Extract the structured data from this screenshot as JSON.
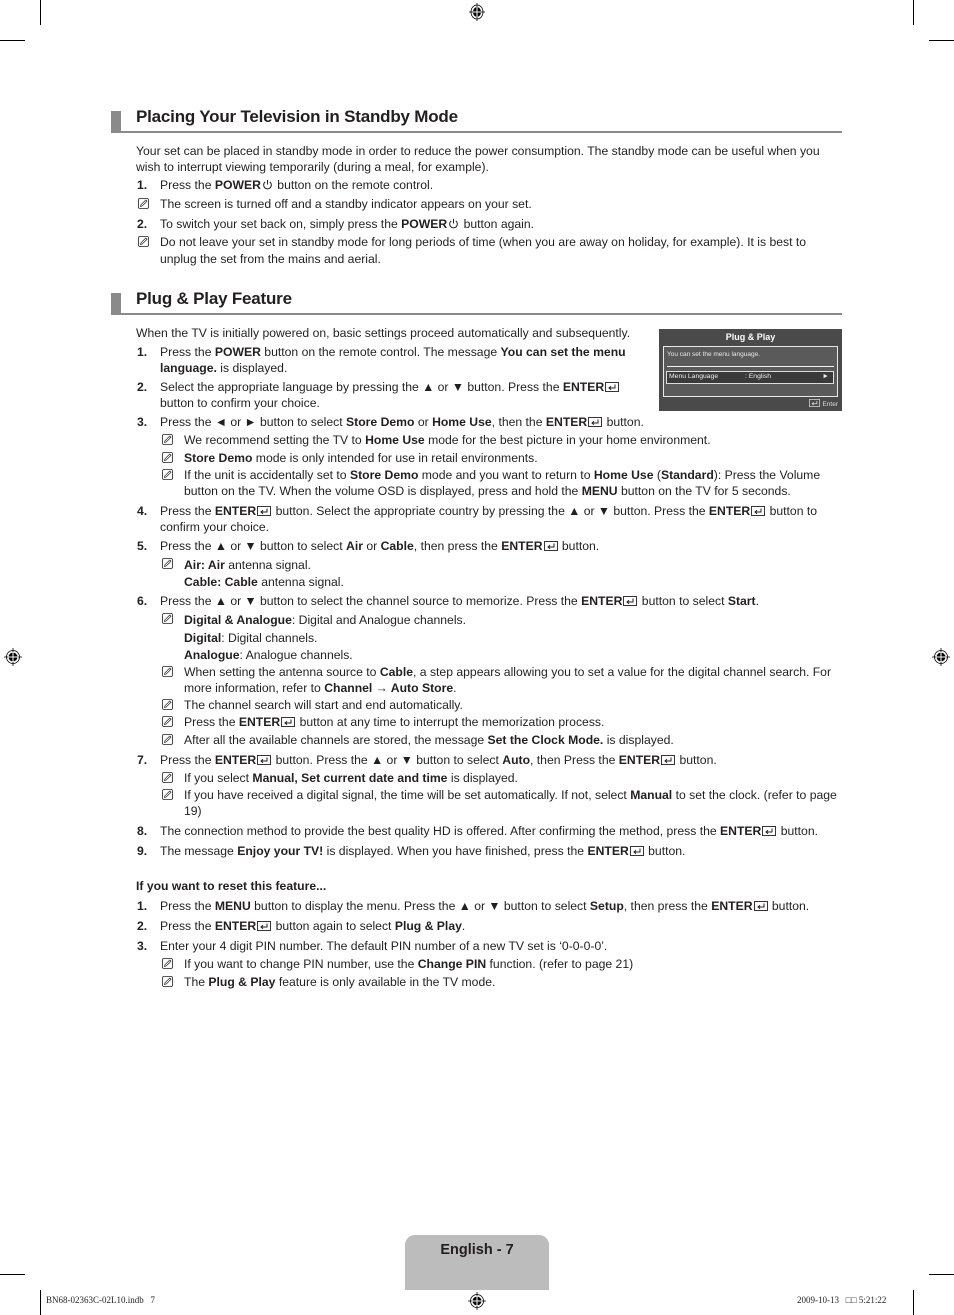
{
  "sections": {
    "standby": {
      "title": "Placing Your Television in Standby Mode",
      "intro_line1": "Your set can be placed in standby mode in order to reduce the power consumption. The standby mode can be useful when you",
      "intro_line2": "wish to interrupt viewing temporarily (during a meal, for example).",
      "step1": {
        "num": "1.",
        "pre": "Press the ",
        "b1": "POWER",
        "post": " button on the remote control."
      },
      "note1": "The screen is turned off and a standby indicator appears on your set.",
      "step2": {
        "num": "2.",
        "pre": "To switch your set back on, simply press the ",
        "b1": "POWER",
        "post": " button again."
      },
      "note2_line1": "Do not leave your set in standby mode for long periods of time (when you are away on holiday, for example). It is best to",
      "note2_line2": "unplug the set from the mains and aerial."
    },
    "plugplay": {
      "title": "Plug & Play Feature",
      "intro": "When the TV is initially powered on, basic settings proceed automatically and subsequently.",
      "s1": {
        "num": "1.",
        "a": "Press the ",
        "b": "POWER",
        "c": " button on the remote control. The message ",
        "d": "You can set the menu",
        "e": "language.",
        "f": " is displayed."
      },
      "s2": {
        "num": "2.",
        "a": "Select the appropriate language by pressing the ▲ or ▼ button. Press the ",
        "b": "ENTER",
        "c": "button to confirm your choice."
      },
      "s3": {
        "num": "3.",
        "a": "Press the ◄ or ► button to select ",
        "b": "Store Demo",
        "c": " or ",
        "d": "Home Use",
        "e": ", then the ",
        "f": "ENTER",
        "g": " button."
      },
      "s3n1": {
        "a": "We recommend setting the TV to ",
        "b": "Home Use",
        "c": " mode for the best picture in your home environment."
      },
      "s3n2": {
        "b": "Store Demo",
        "c": " mode is only intended for use in retail environments."
      },
      "s3n3": {
        "a": "If the unit is accidentally set to ",
        "b": "Store Demo",
        "c": " mode and you want to return to ",
        "d": "Home Use",
        "e": " (",
        "f": "Standard",
        "g": "): Press the Volume",
        "h": "button on the TV. When the volume OSD is displayed, press and hold the ",
        "i": "MENU",
        "j": " button on the TV for 5 seconds."
      },
      "s4": {
        "num": "4.",
        "a": "Press the ",
        "b": "ENTER",
        "c": " button. Select the appropriate country by pressing the ▲ or ▼ button. Press the ",
        "d": "ENTER",
        "e": " button to",
        "f": "confirm your choice."
      },
      "s5": {
        "num": "5.",
        "a": "Press the ▲ or ▼ button to select ",
        "b": "Air",
        "c": " or ",
        "d": "Cable",
        "e": ", then press the ",
        "f": "ENTER",
        "g": " button."
      },
      "s5n1": {
        "b": "Air: Air",
        "c": " antenna signal."
      },
      "s5n1b": {
        "b": "Cable: Cable",
        "c": " antenna signal."
      },
      "s6": {
        "num": "6.",
        "a": "Press the ▲ or ▼ button to select the channel source to memorize. Press the ",
        "b": "ENTER",
        "c": " button to select ",
        "d": "Start",
        "e": "."
      },
      "s6n1": {
        "b": "Digital & Analogue",
        "c": ": Digital and Analogue channels."
      },
      "s6n1b": {
        "b": "Digital",
        "c": ": Digital channels."
      },
      "s6n1c": {
        "b": "Analogue",
        "c": ": Analogue channels."
      },
      "s6n2": {
        "a": "When setting the antenna source to ",
        "b": "Cable",
        "c": ", a step appears allowing you to set a value for the digital channel search. For",
        "d": "more information, refer to ",
        "e": "Channel → Auto Store",
        "f": "."
      },
      "s6n3": "The channel search will start and end automatically.",
      "s6n4": {
        "a": "Press the ",
        "b": "ENTER",
        "c": " button at any time to interrupt the memorization process."
      },
      "s6n5": {
        "a": "After all the available channels are stored, the message ",
        "b": "Set the Clock Mode.",
        "c": " is displayed."
      },
      "s7": {
        "num": "7.",
        "a": "Press the ",
        "b": "ENTER",
        "c": " button. Press the ▲ or ▼ button to select ",
        "d": "Auto",
        "e": ", then Press the ",
        "f": "ENTER",
        "g": " button."
      },
      "s7n1": {
        "a": "If you select ",
        "b": "Manual, Set current date and time",
        "c": " is displayed."
      },
      "s7n2": {
        "a": "If you have received a digital signal, the time will be set automatically. If not, select ",
        "b": "Manual",
        "c": " to set the clock. (refer to page",
        "d": "19)"
      },
      "s8": {
        "num": "8.",
        "a": "The connection method to provide the best quality HD is offered. After confirming the method, press the ",
        "b": "ENTER",
        "c": " button."
      },
      "s9": {
        "num": "9.",
        "a": "The message ",
        "b": "Enjoy your TV!",
        "c": " is displayed. When you have finished, press the ",
        "d": "ENTER",
        "e": " button."
      },
      "reset_heading": "If you want to reset this feature...",
      "r1": {
        "num": "1.",
        "a": "Press the ",
        "b": "MENU",
        "c": " button to display the menu. Press the ▲ or ▼ button to select ",
        "d": "Setup",
        "e": ", then press the ",
        "f": "ENTER",
        "g": " button."
      },
      "r2": {
        "num": "2.",
        "a": "Press the ",
        "b": "ENTER",
        "c": " button again to select ",
        "d": "Plug & Play",
        "e": "."
      },
      "r3": {
        "num": "3.",
        "a": "Enter your 4 digit PIN number. The default PIN number of a new TV set is ‘0-0-0-0’."
      },
      "r3n1": {
        "a": "If you want to change PIN number, use the ",
        "b": "Change PIN",
        "c": " function. (refer to page 21)"
      },
      "r3n2": {
        "a": "The ",
        "b": "Plug & Play",
        "c": " feature is only available in the TV mode."
      }
    }
  },
  "osd": {
    "title": "Plug & Play",
    "message": "You can set the menu language.",
    "menu_label": "Menu Language",
    "menu_value": ": English",
    "arrow": "►",
    "footer": "Enter"
  },
  "footer": {
    "page_label": "English - 7",
    "slug_left": "BN68-02363C-02L10.indb   7",
    "slug_right": "2009-10-13   □□ 5:21:22"
  }
}
